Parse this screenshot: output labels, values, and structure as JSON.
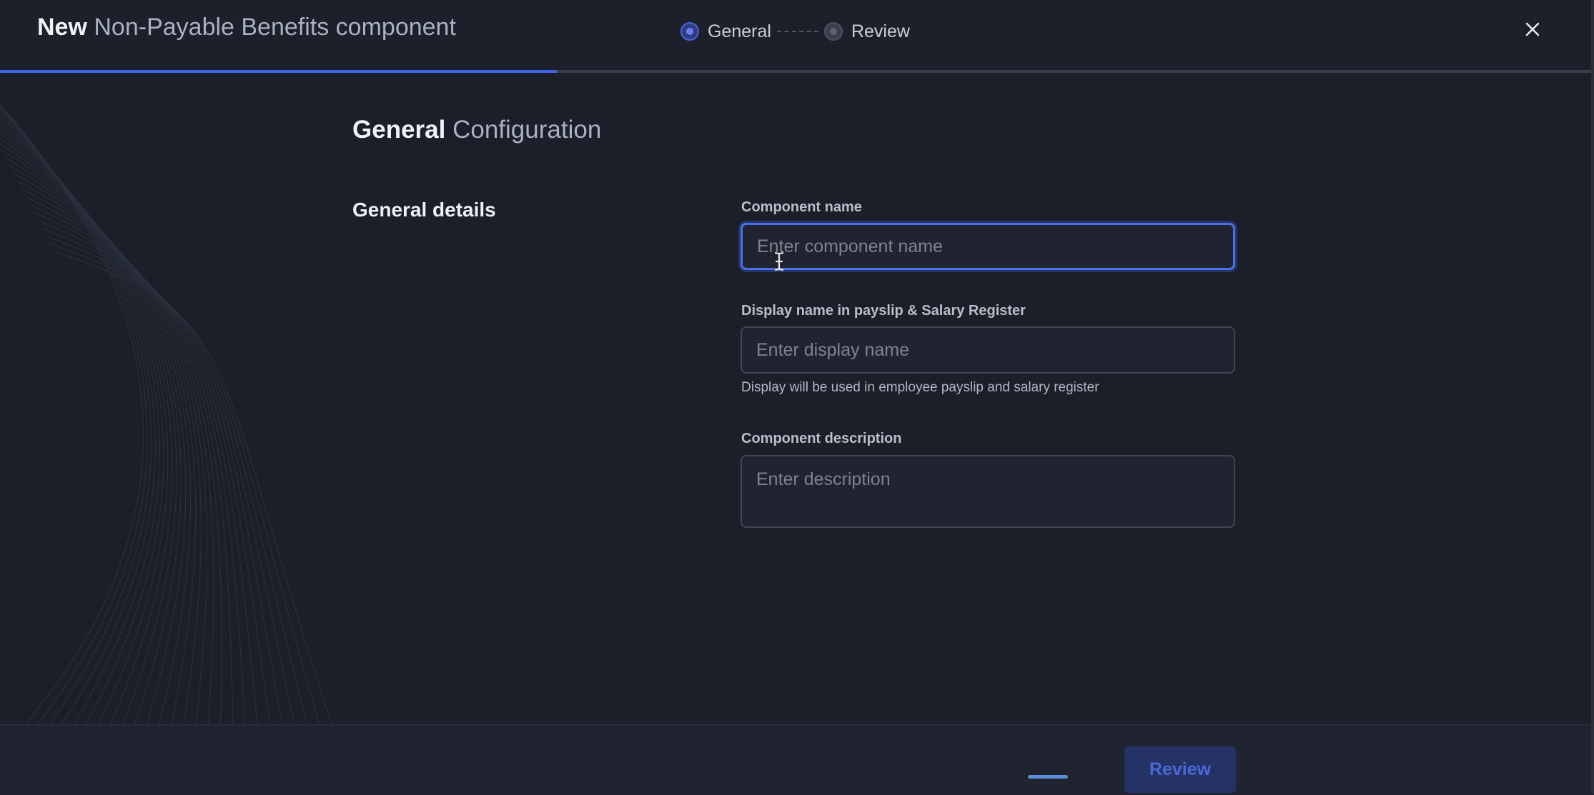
{
  "header": {
    "title_strong": "New",
    "title_rest": "Non-Payable Benefits component",
    "close_icon": "close-icon",
    "progress_percent": 35
  },
  "stepper": {
    "steps": [
      {
        "label": "General",
        "state": "active"
      },
      {
        "label": "Review",
        "state": "inactive"
      }
    ]
  },
  "section": {
    "title_strong": "General",
    "title_rest": "Configuration",
    "group_label": "General details"
  },
  "form": {
    "component_name": {
      "label": "Component name",
      "placeholder": "Enter component name",
      "value": ""
    },
    "display_name": {
      "label": "Display name in payslip & Salary Register",
      "placeholder": "Enter display name",
      "value": "",
      "helper": "Display will be used in employee payslip and salary register"
    },
    "description": {
      "label": "Component description",
      "placeholder": "Enter description",
      "value": ""
    }
  },
  "footer": {
    "review_label": "Review"
  },
  "colors": {
    "accent": "#3d64e6",
    "background": "#1a1f29",
    "button_disabled": "#243266"
  }
}
